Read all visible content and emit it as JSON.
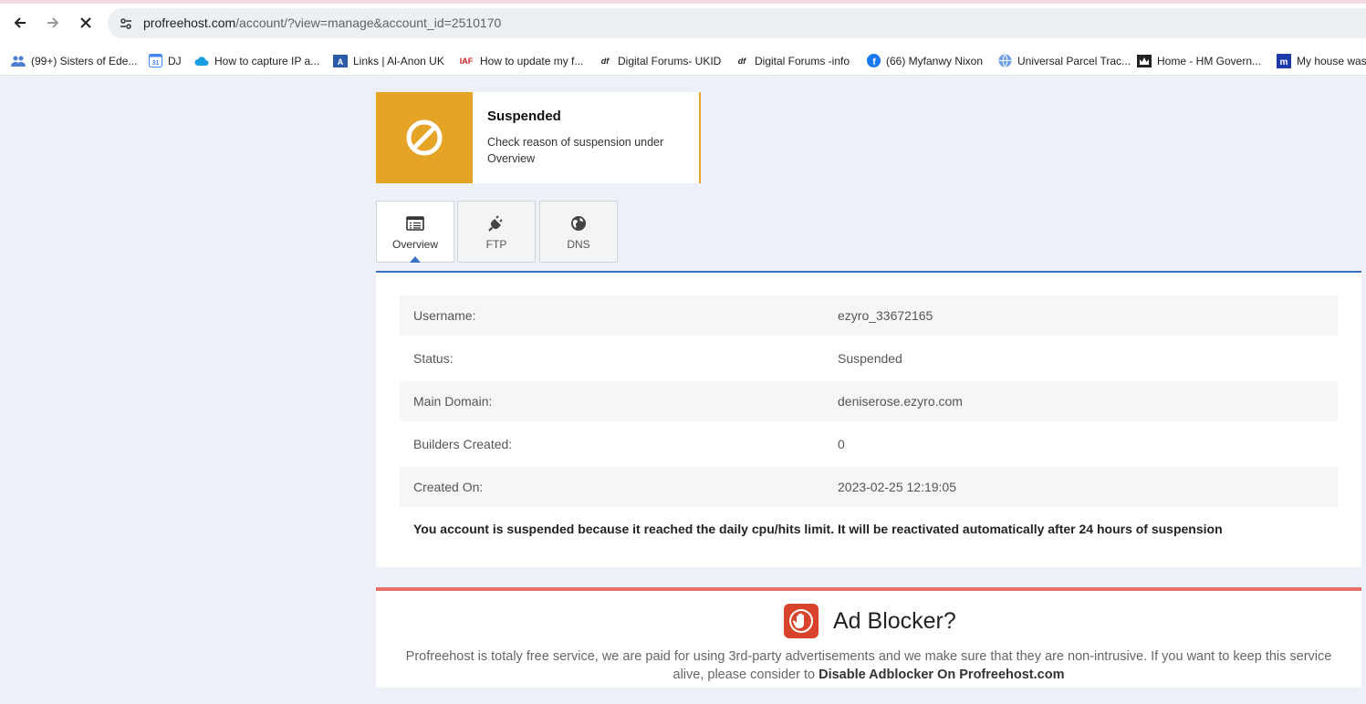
{
  "browser": {
    "url_domain": "profreehost.com",
    "url_path": "/account/?view=manage&account_id=2510170",
    "back_icon": "arrow-left-icon",
    "forward_icon": "arrow-right-icon",
    "stop_icon": "close-icon",
    "site_settings_icon": "tune-icon"
  },
  "bookmarks": [
    {
      "label": "(99+) Sisters of Ede...",
      "icon": "people-icon"
    },
    {
      "label": "DJ",
      "icon": "calendar-icon"
    },
    {
      "label": "How to capture IP a...",
      "icon": "cloud-icon"
    },
    {
      "label": "Links | Al-Anon UK",
      "icon": "alanon-icon"
    },
    {
      "label": "How to update my f...",
      "icon": "iaf-icon"
    },
    {
      "label": "Digital Forums- UKID",
      "icon": "df-icon"
    },
    {
      "label": "Digital Forums -info",
      "icon": "df-icon"
    },
    {
      "label": "(66) Myfanwy Nixon",
      "icon": "facebook-icon"
    },
    {
      "label": "Universal Parcel Trac...",
      "icon": "globe-icon"
    },
    {
      "label": "Home - HM Govern...",
      "icon": "crown-icon"
    },
    {
      "label": "My house was",
      "icon": "m-icon"
    }
  ],
  "banner": {
    "title": "Suspended",
    "description": "Check reason of suspension under Overview",
    "icon": "ban-icon",
    "color": "#e6a426"
  },
  "tabs": [
    {
      "label": "Overview",
      "icon": "list-icon",
      "active": true
    },
    {
      "label": "FTP",
      "icon": "plug-icon",
      "active": false
    },
    {
      "label": "DNS",
      "icon": "globe-icon",
      "active": false
    }
  ],
  "details": [
    {
      "key": "Username:",
      "value": "ezyro_33672165"
    },
    {
      "key": "Status:",
      "value": "Suspended"
    },
    {
      "key": "Main Domain:",
      "value": "deniserose.ezyro.com"
    },
    {
      "key": "Builders Created:",
      "value": "0"
    },
    {
      "key": "Created On:",
      "value": "2023-02-25 12:19:05"
    }
  ],
  "notice": "You account is suspended because it reached the daily cpu/hits limit. It will be reactivated automatically after 24 hours of suspension",
  "adblock": {
    "title": "Ad Blocker?",
    "icon": "stop-hand-icon",
    "message": "Profreehost is totaly free service, we are paid for using 3rd-party advertisements and we make sure that they are non-intrusive. If you want to keep this service alive, please consider to ",
    "message_bold": "Disable Adblocker On Profreehost.com",
    "accent": "#e8716a"
  },
  "colors": {
    "accent_blue": "#3a70c4",
    "page_bg": "#edf1f7"
  }
}
